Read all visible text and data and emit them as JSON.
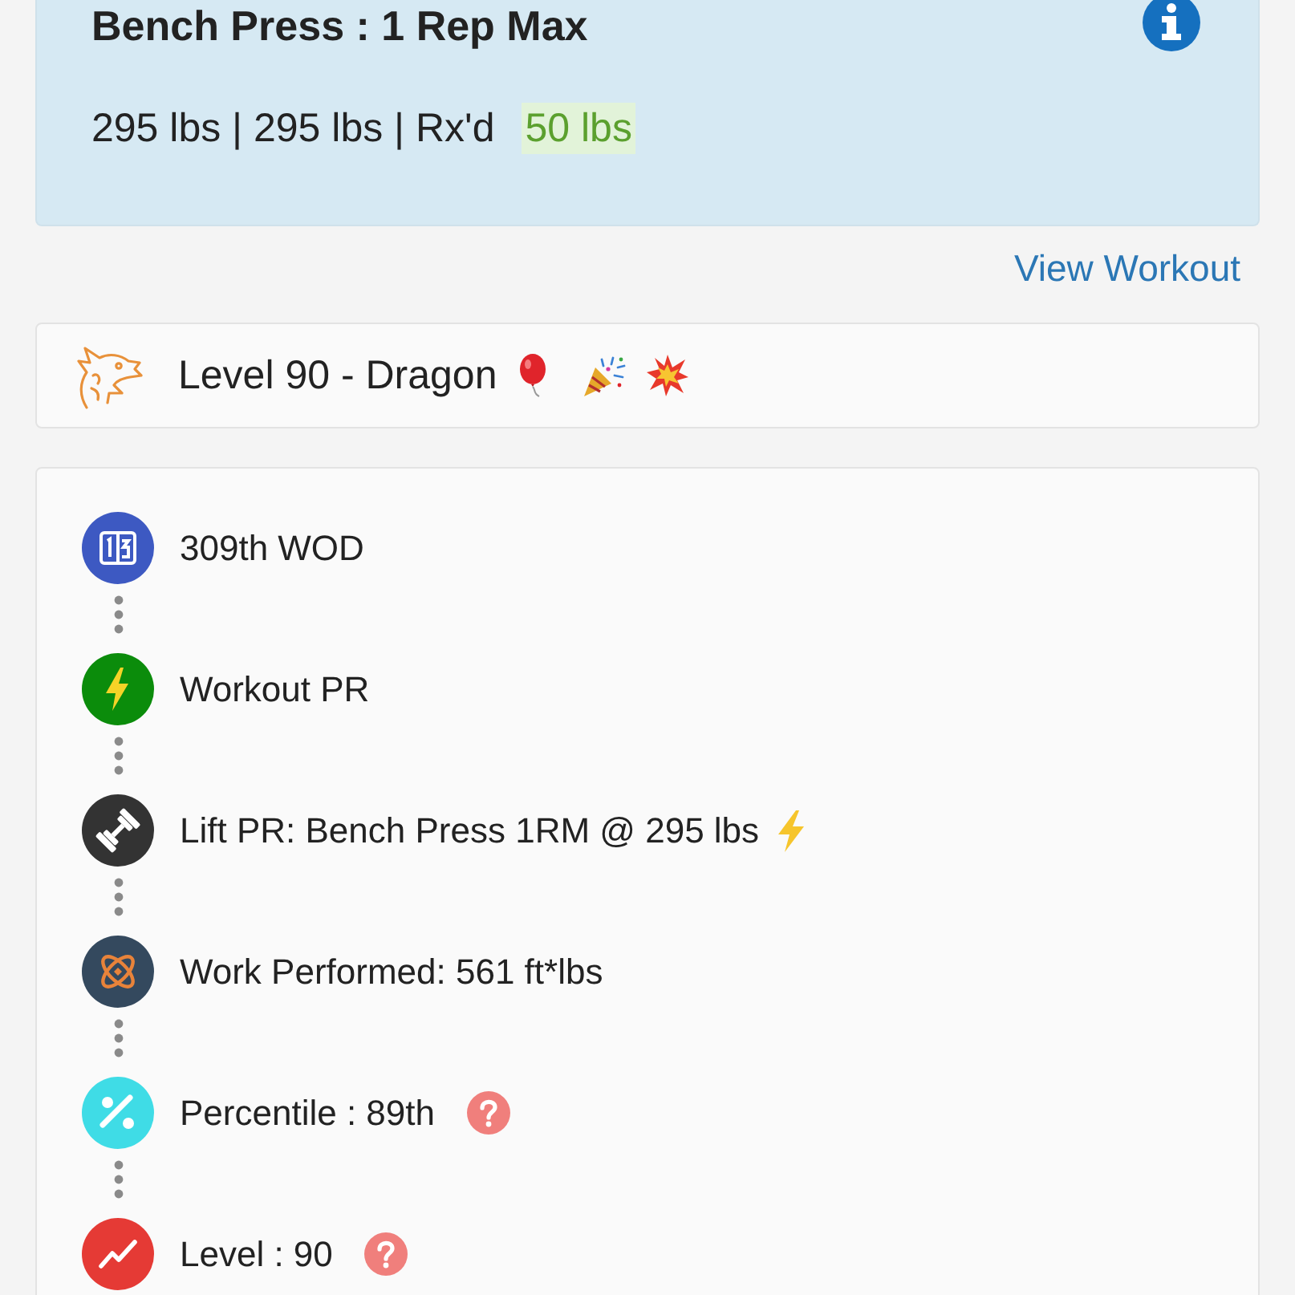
{
  "result_card": {
    "title": "Bench Press : 1 Rep Max",
    "score": "295 lbs | 295 lbs | Rx'd",
    "weight": "50 lbs"
  },
  "view_workout_link": "View Workout",
  "level_badge": {
    "label": "Level 90 - Dragon"
  },
  "timeline": [
    {
      "label": "309th WOD",
      "color": "#3d59c2",
      "help": false,
      "bolt": false
    },
    {
      "label": "Workout PR",
      "color": "#0b8c0b",
      "help": false,
      "bolt": false
    },
    {
      "label": "Lift PR: Bench Press 1RM @ 295 lbs",
      "color": "#333333",
      "help": false,
      "bolt": true
    },
    {
      "label": "Work Performed: 561 ft*lbs",
      "color": "#34495e",
      "help": false,
      "bolt": false
    },
    {
      "label": "Percentile : 89th",
      "color": "#3fdce6",
      "help": true,
      "bolt": false
    },
    {
      "label": "Level : 90",
      "color": "#e53a35",
      "help": true,
      "bolt": false
    }
  ]
}
